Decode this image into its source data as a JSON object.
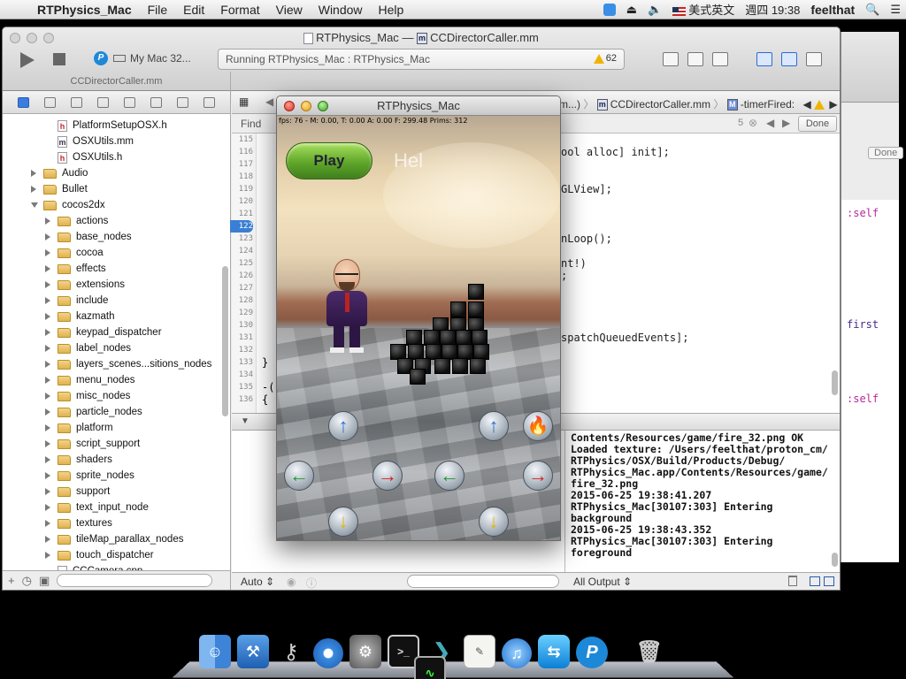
{
  "menubar": {
    "app_name": "RTPhysics_Mac",
    "items": [
      "File",
      "Edit",
      "Format",
      "View",
      "Window",
      "Help"
    ],
    "input_method": "美式英文",
    "clock": "週四 19:38",
    "user": "feelthat"
  },
  "xcode": {
    "window_title_project": "RTPhysics_Mac",
    "window_title_sep": "—",
    "window_title_file": "CCDirectorCaller.mm",
    "scheme_target": "My Mac 32...",
    "activity_text": "Running RTPhysics_Mac : RTPhysics_Mac",
    "warning_count": "62",
    "tab_left": "CCDirectorCaller.mm",
    "navigator": [
      {
        "indent": 1,
        "kind": "h",
        "label": "PlatformSetupOSX.h"
      },
      {
        "indent": 1,
        "kind": "m",
        "label": "OSXUtils.mm"
      },
      {
        "indent": 1,
        "kind": "h",
        "label": "OSXUtils.h"
      },
      {
        "indent": 0,
        "kind": "folder",
        "label": "Audio"
      },
      {
        "indent": 0,
        "kind": "folder",
        "label": "Bullet"
      },
      {
        "indent": 0,
        "kind": "folder-open",
        "label": "cocos2dx"
      },
      {
        "indent": 1,
        "kind": "folder",
        "label": "actions"
      },
      {
        "indent": 1,
        "kind": "folder",
        "label": "base_nodes"
      },
      {
        "indent": 1,
        "kind": "folder",
        "label": "cocoa"
      },
      {
        "indent": 1,
        "kind": "folder",
        "label": "effects"
      },
      {
        "indent": 1,
        "kind": "folder",
        "label": "extensions"
      },
      {
        "indent": 1,
        "kind": "folder",
        "label": "include"
      },
      {
        "indent": 1,
        "kind": "folder",
        "label": "kazmath"
      },
      {
        "indent": 1,
        "kind": "folder",
        "label": "keypad_dispatcher"
      },
      {
        "indent": 1,
        "kind": "folder",
        "label": "label_nodes"
      },
      {
        "indent": 1,
        "kind": "folder",
        "label": "layers_scenes...sitions_nodes"
      },
      {
        "indent": 1,
        "kind": "folder",
        "label": "menu_nodes"
      },
      {
        "indent": 1,
        "kind": "folder",
        "label": "misc_nodes"
      },
      {
        "indent": 1,
        "kind": "folder",
        "label": "particle_nodes"
      },
      {
        "indent": 1,
        "kind": "folder",
        "label": "platform"
      },
      {
        "indent": 1,
        "kind": "folder",
        "label": "script_support"
      },
      {
        "indent": 1,
        "kind": "folder",
        "label": "shaders"
      },
      {
        "indent": 1,
        "kind": "folder",
        "label": "sprite_nodes"
      },
      {
        "indent": 1,
        "kind": "folder",
        "label": "support"
      },
      {
        "indent": 1,
        "kind": "folder",
        "label": "text_input_node"
      },
      {
        "indent": 1,
        "kind": "folder",
        "label": "textures"
      },
      {
        "indent": 1,
        "kind": "folder",
        "label": "tileMap_parallax_nodes"
      },
      {
        "indent": 1,
        "kind": "folder",
        "label": "touch_dispatcher"
      },
      {
        "indent": 1,
        "kind": "cpp",
        "label": "CCCamera.cpp"
      }
    ],
    "jumpbar": {
      "partial": "m...)",
      "file": "CCDirectorCaller.mm",
      "method": "-timerFired:"
    },
    "find": {
      "label": "Find",
      "count": "5",
      "done": "Done"
    },
    "line_numbers": [
      "115",
      "116",
      "117",
      "118",
      "119",
      "120",
      "121",
      "122",
      "123",
      "124",
      "125",
      "126",
      "127",
      "128",
      "129",
      "130",
      "131",
      "132",
      "133",
      "134",
      "135",
      "136"
    ],
    "current_line": "122",
    "code_lines": [
      "",
      "",
      "",
      "",
      "",
      "",
      "",
      "",
      "",
      "",
      "",
      "",
      "",
      "",
      "",
      "",
      "",
      "",
      "}",
      "",
      "-(",
      "{"
    ],
    "code_right_lines": [
      {
        "line": 1,
        "text": "ool alloc] init];"
      },
      {
        "line": 4,
        "text": "GLView];"
      },
      {
        "line": 8,
        "text": "nLoop();"
      },
      {
        "line": 10,
        "text": "nt!)"
      },
      {
        "line": 11,
        "text": ";"
      },
      {
        "line": 16,
        "text": "spatchQueuedEvents];"
      }
    ],
    "console_lines": [
      "Contents/Resources/game/fire_32.png OK",
      "Loaded texture: /Users/feelthat/proton_cm/",
      "RTPhysics/OSX/Build/Products/Debug/",
      "RTPhysics_Mac.app/Contents/Resources/game/",
      "fire_32.png",
      "2015-06-25 19:38:41.207",
      "RTPhysics_Mac[30107:303] Entering",
      "background",
      "2015-06-25 19:38:43.352",
      "RTPhysics_Mac[30107:303] Entering",
      "foreground"
    ],
    "footer": {
      "auto": "Auto ⇕",
      "all_output": "All Output ⇕"
    }
  },
  "background_window": {
    "code": [
      ":self",
      "first",
      ":self"
    ],
    "done": "Done"
  },
  "game": {
    "title": "RTPhysics_Mac",
    "fps": "fps: 76 - M: 0.00, T: 0.00 A: 0.00 F: 299.48 Prims: 312",
    "play": "Play",
    "hello": "Hel"
  },
  "dock": {
    "items": [
      "finder",
      "xcode",
      "keychain-access",
      "safari",
      "system-preferences",
      "activity-monitor",
      "terminal",
      "instruments",
      "textedit",
      "itunes",
      "teamviewer",
      "proton",
      "trash"
    ]
  }
}
